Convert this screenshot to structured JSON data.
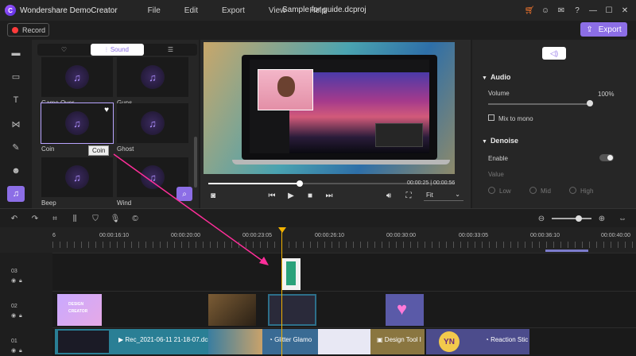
{
  "app": {
    "name": "Wondershare DemoCreator",
    "document_title": "Sample for guide.dcproj"
  },
  "menu": [
    "File",
    "Edit",
    "Export",
    "View",
    "Help"
  ],
  "toolbar": {
    "record_label": "Record",
    "export_label": "Export"
  },
  "library": {
    "tabs": [
      {
        "label": "♡"
      },
      {
        "label": "Sound"
      },
      {
        "label": "☰"
      }
    ],
    "items": [
      {
        "name": "Game Over"
      },
      {
        "name": "Guns"
      },
      {
        "name": "Coin"
      },
      {
        "name": "Ghost"
      },
      {
        "name": "Beep"
      },
      {
        "name": "Wind"
      }
    ],
    "tooltip": "Coin"
  },
  "preview": {
    "time_current": "00:00:25",
    "time_total": "00:00:56",
    "time_separator": "|",
    "fit_label": "Fit",
    "progress_fraction": 0.37
  },
  "properties": {
    "audio_heading": "Audio",
    "volume_label": "Volume",
    "volume_value": "100%",
    "mix_to_mono_label": "Mix to mono",
    "denoise_heading": "Denoise",
    "enable_label": "Enable",
    "value_label": "Value",
    "levels": [
      "Low",
      "Mid",
      "High"
    ]
  },
  "ruler": {
    "labels": [
      "6",
      "00:00:16:10",
      "00:00:20:00",
      "00:00:23:05",
      "00:00:26:10",
      "00:00:30:00",
      "00:00:33:05",
      "00:00:36:10",
      "00:00:40:00"
    ]
  },
  "tracks": [
    {
      "number": "03"
    },
    {
      "number": "02"
    },
    {
      "number": "01"
    }
  ],
  "clips": {
    "design_creator_top": "DESIGN",
    "design_creator_bottom": "CREATOR",
    "rec_clip": "Rec_2021-06-11 21-18-07.dcrc",
    "glitter_clip": "Glitter Glamo",
    "design_tool_clip": "Design Tool I",
    "reaction_clip": "Reaction Stic",
    "yn_sticker": "YN"
  },
  "colors": {
    "accent": "#8c6ee6",
    "playhead": "#f2b200",
    "drag_arrow": "#ff2e9a",
    "record_dot": "#ff3b3b"
  }
}
